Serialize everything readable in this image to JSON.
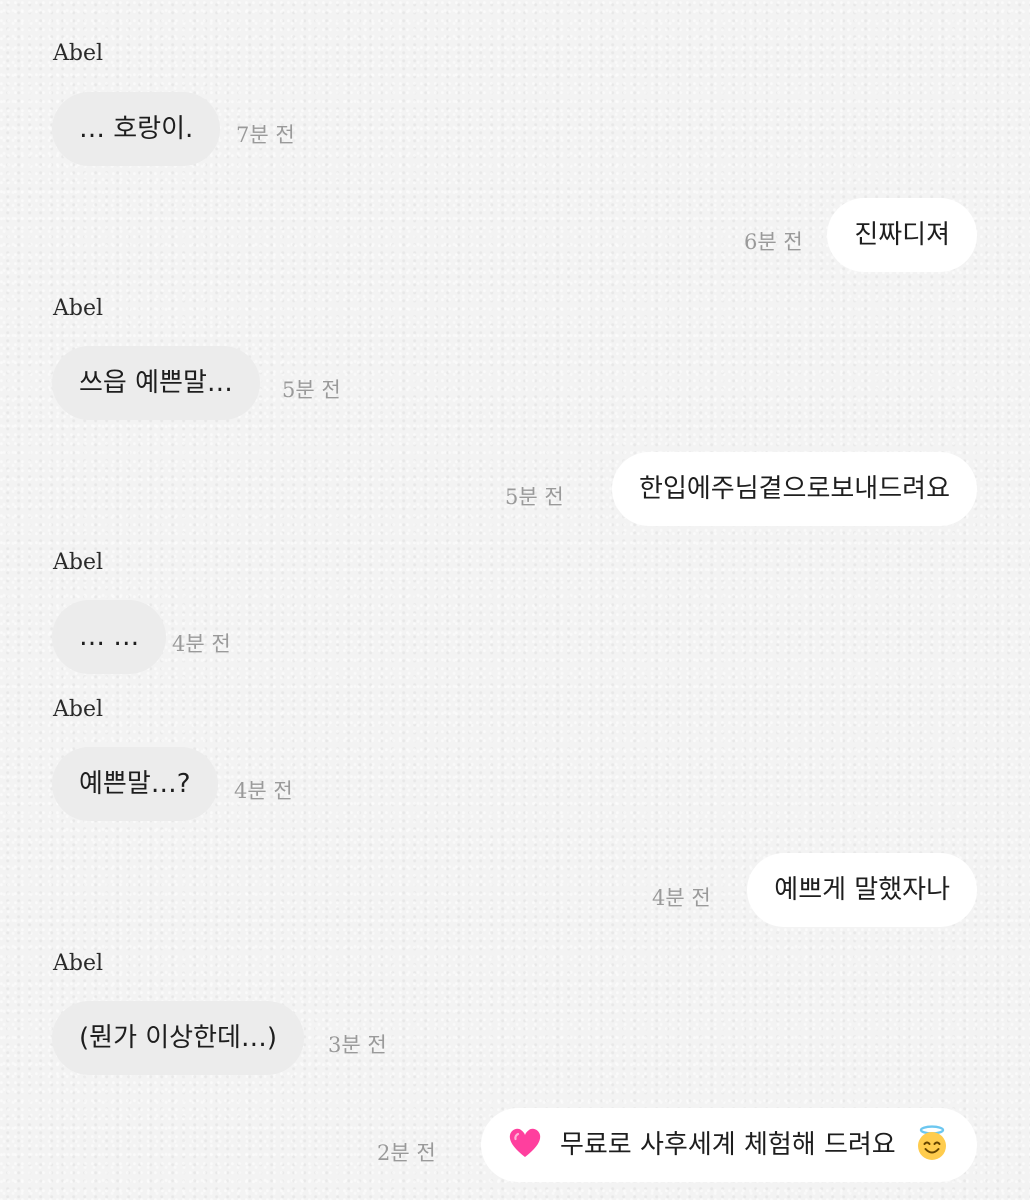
{
  "messages": [
    {
      "sender": "Abel",
      "text": "… 호랑이.",
      "time": "7분 전"
    },
    {
      "text": "진짜디져",
      "time": "6분 전"
    },
    {
      "sender": "Abel",
      "text": "쓰읍 예쁜말…",
      "time": "5분 전"
    },
    {
      "text": "한입에주님곁으로보내드려요",
      "time": "5분 전"
    },
    {
      "sender": "Abel",
      "text": "… …",
      "time": "4분 전"
    },
    {
      "sender": "Abel",
      "text": "예쁜말…?",
      "time": "4분 전"
    },
    {
      "text": "예쁘게 말했자나",
      "time": "4분 전"
    },
    {
      "sender": "Abel",
      "text": "(뭔가 이상한데…)",
      "time": "3분 전"
    },
    {
      "text": "무료로 사후세계 체험해 드려요",
      "time": "2분 전",
      "emoji_before": "growing-heart-icon",
      "emoji_after": "smiling-face-with-halo-icon"
    }
  ],
  "colors": {
    "background": "#f3f3f3",
    "incoming_bubble": "#ececec",
    "outgoing_bubble": "#ffffff",
    "timestamp": "#9a9a9a"
  }
}
